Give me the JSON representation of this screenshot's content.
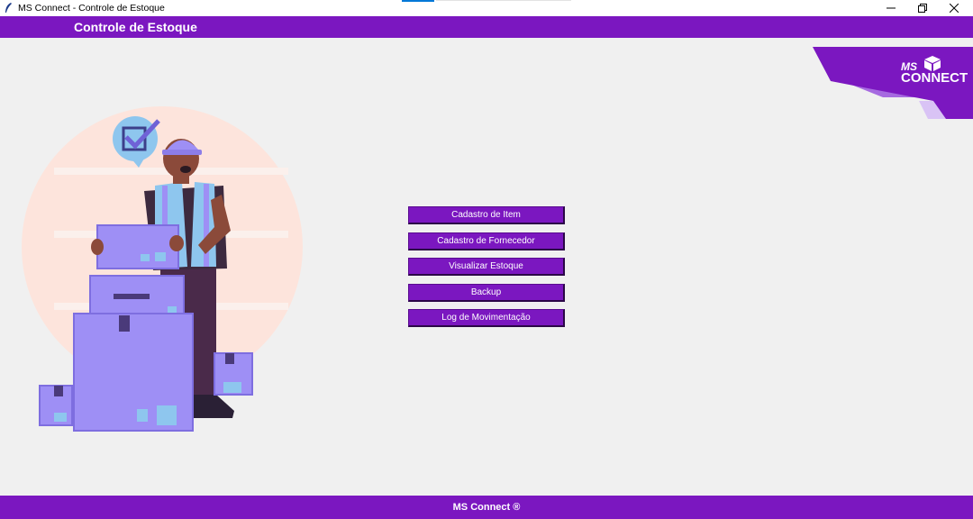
{
  "window": {
    "title": "MS Connect - Controle de Estoque"
  },
  "header": {
    "title": "Controle de Estoque"
  },
  "logo": {
    "line1": "MS",
    "line2": "CONNECT"
  },
  "menu": [
    {
      "label": "Cadastro de Item"
    },
    {
      "label": "Cadastro de Fornecedor"
    },
    {
      "label": "Visualizar Estoque"
    },
    {
      "label": "Backup"
    },
    {
      "label": "Log de Movimentação"
    }
  ],
  "footer": {
    "text": "MS Connect ®"
  },
  "colors": {
    "accent": "#7b17c0",
    "background": "#f0f0f0",
    "box": "#9e8ff5",
    "vest": "#8ec6ee",
    "peach": "#fde4dc"
  },
  "icons": [
    "feather-icon",
    "minimize-icon",
    "restore-icon",
    "close-icon",
    "checkmark-bubble-icon",
    "cube-icon"
  ]
}
